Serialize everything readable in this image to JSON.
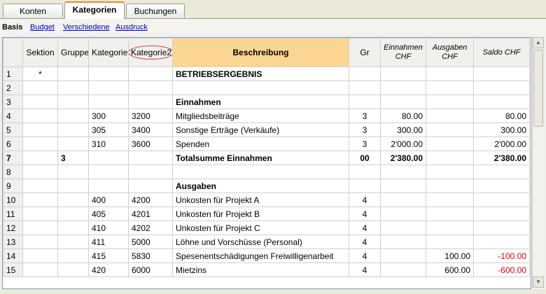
{
  "tabs": [
    {
      "label": "Konten",
      "active": false
    },
    {
      "label": "Kategorien",
      "active": true
    },
    {
      "label": "Buchungen",
      "active": false
    }
  ],
  "views": {
    "current": "Basis",
    "links": [
      "Budget",
      "Verschiedene",
      "Ausdruck"
    ]
  },
  "columns": {
    "sektion": "Sektion",
    "gruppe": "Gruppe",
    "kategorie": "Kategorie",
    "kategorie2": "Kategorie2",
    "beschreibung": "Beschreibung",
    "gr": "Gr",
    "einnahmen_l1": "Einnahmen",
    "einnahmen_l2": "CHF",
    "ausgaben_l1": "Ausgaben",
    "ausgaben_l2": "CHF",
    "saldo": "Saldo CHF"
  },
  "rows": [
    {
      "n": "1",
      "sektion": "*",
      "gruppe": "",
      "kat": "",
      "kat2": "",
      "beschr": "BETRIEBSERGEBNIS",
      "gr": "",
      "ein": "",
      "aus": "",
      "saldo": "",
      "bold": false,
      "beschr_bold": true,
      "neg": false
    },
    {
      "n": "2",
      "sektion": "",
      "gruppe": "",
      "kat": "",
      "kat2": "",
      "beschr": "",
      "gr": "",
      "ein": "",
      "aus": "",
      "saldo": "",
      "bold": false,
      "beschr_bold": false,
      "neg": false
    },
    {
      "n": "3",
      "sektion": "",
      "gruppe": "",
      "kat": "",
      "kat2": "",
      "beschr": "Einnahmen",
      "gr": "",
      "ein": "",
      "aus": "",
      "saldo": "",
      "bold": false,
      "beschr_bold": true,
      "neg": false
    },
    {
      "n": "4",
      "sektion": "",
      "gruppe": "",
      "kat": "300",
      "kat2": "3200",
      "beschr": "Mitgliedsbeiträge",
      "gr": "3",
      "ein": "80.00",
      "aus": "",
      "saldo": "80.00",
      "bold": false,
      "beschr_bold": false,
      "neg": false
    },
    {
      "n": "5",
      "sektion": "",
      "gruppe": "",
      "kat": "305",
      "kat2": "3400",
      "beschr": "Sonstige Erträge (Verkäufe)",
      "gr": "3",
      "ein": "300.00",
      "aus": "",
      "saldo": "300.00",
      "bold": false,
      "beschr_bold": false,
      "neg": false
    },
    {
      "n": "6",
      "sektion": "",
      "gruppe": "",
      "kat": "310",
      "kat2": "3600",
      "beschr": "Spenden",
      "gr": "3",
      "ein": "2'000.00",
      "aus": "",
      "saldo": "2'000.00",
      "bold": false,
      "beschr_bold": false,
      "neg": false
    },
    {
      "n": "7",
      "sektion": "",
      "gruppe": "3",
      "kat": "",
      "kat2": "",
      "beschr": "Totalsumme Einnahmen",
      "gr": "00",
      "ein": "2'380.00",
      "aus": "",
      "saldo": "2'380.00",
      "bold": true,
      "beschr_bold": true,
      "neg": false
    },
    {
      "n": "8",
      "sektion": "",
      "gruppe": "",
      "kat": "",
      "kat2": "",
      "beschr": "",
      "gr": "",
      "ein": "",
      "aus": "",
      "saldo": "",
      "bold": false,
      "beschr_bold": false,
      "neg": false
    },
    {
      "n": "9",
      "sektion": "",
      "gruppe": "",
      "kat": "",
      "kat2": "",
      "beschr": "Ausgaben",
      "gr": "",
      "ein": "",
      "aus": "",
      "saldo": "",
      "bold": false,
      "beschr_bold": true,
      "neg": false
    },
    {
      "n": "10",
      "sektion": "",
      "gruppe": "",
      "kat": "400",
      "kat2": "4200",
      "beschr": "Unkosten für Projekt A",
      "gr": "4",
      "ein": "",
      "aus": "",
      "saldo": "",
      "bold": false,
      "beschr_bold": false,
      "neg": false
    },
    {
      "n": "11",
      "sektion": "",
      "gruppe": "",
      "kat": "405",
      "kat2": "4201",
      "beschr": "Unkosten für Projekt B",
      "gr": "4",
      "ein": "",
      "aus": "",
      "saldo": "",
      "bold": false,
      "beschr_bold": false,
      "neg": false
    },
    {
      "n": "12",
      "sektion": "",
      "gruppe": "",
      "kat": "410",
      "kat2": "4202",
      "beschr": "Unkosten für Projekt C",
      "gr": "4",
      "ein": "",
      "aus": "",
      "saldo": "",
      "bold": false,
      "beschr_bold": false,
      "neg": false
    },
    {
      "n": "13",
      "sektion": "",
      "gruppe": "",
      "kat": "411",
      "kat2": "5000",
      "beschr": "Löhne und Vorschüsse (Personal)",
      "gr": "4",
      "ein": "",
      "aus": "",
      "saldo": "",
      "bold": false,
      "beschr_bold": false,
      "neg": false
    },
    {
      "n": "14",
      "sektion": "",
      "gruppe": "",
      "kat": "415",
      "kat2": "5830",
      "beschr": "Spesenentschädigungen Freiwilligenarbeit",
      "gr": "4",
      "ein": "",
      "aus": "100.00",
      "saldo": "-100.00",
      "bold": false,
      "beschr_bold": false,
      "neg": true
    },
    {
      "n": "15",
      "sektion": "",
      "gruppe": "",
      "kat": "420",
      "kat2": "6000",
      "beschr": "Mietzins",
      "gr": "4",
      "ein": "",
      "aus": "600.00",
      "saldo": "-600.00",
      "bold": false,
      "beschr_bold": false,
      "neg": true
    }
  ],
  "colors": {
    "accent_tab": "#e68b2c",
    "header_highlight": "#fbd592",
    "negative": "#e00000",
    "circle": "#e0303a"
  },
  "icons": {
    "scroll_up": "▲",
    "scroll_down": "▼"
  }
}
